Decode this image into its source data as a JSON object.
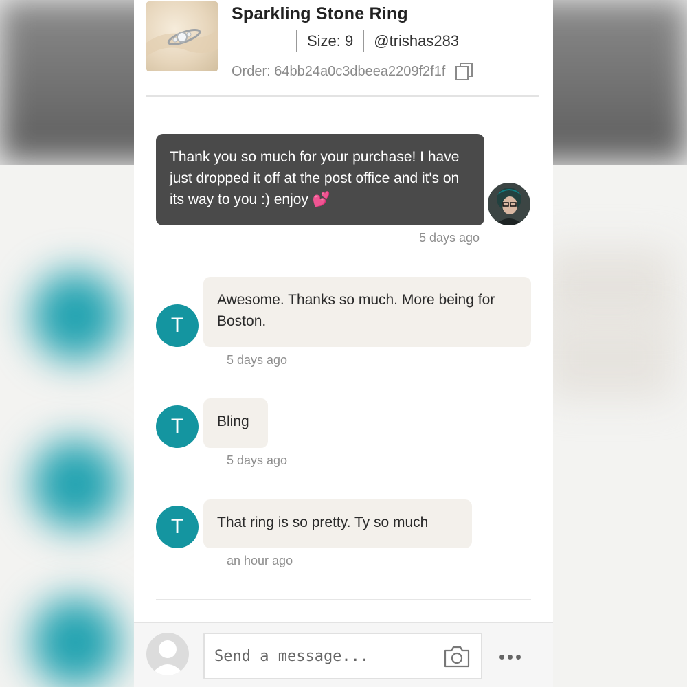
{
  "order": {
    "product_title": "Sparkling Stone Ring",
    "size_text": "Size: 9",
    "username": "@trishas283",
    "order_text": "Order: 64bb24a0c3dbeea2209f2f1f"
  },
  "messages": [
    {
      "from": "seller",
      "text": "Thank you so much for your purchase! I have just dropped it off at the post office and it's on its way to you :) enjoy 💕",
      "time": "5 days ago"
    },
    {
      "from": "buyer",
      "initial": "T",
      "text": "Awesome. Thanks so much. More being for Boston.",
      "time": "5 days ago"
    },
    {
      "from": "buyer",
      "initial": "T",
      "text": "Bling",
      "time": "5 days ago"
    },
    {
      "from": "buyer",
      "initial": "T",
      "text": "That ring is so pretty. Ty so much",
      "time": "an hour ago"
    }
  ],
  "composer": {
    "placeholder": "Send a message...",
    "camera_icon": "camera-icon",
    "more_icon": "more-options-icon"
  },
  "colors": {
    "buyer_avatar": "#1495a0",
    "seller_bubble": "#4a4a4a",
    "buyer_bubble": "#f3f0eb"
  }
}
